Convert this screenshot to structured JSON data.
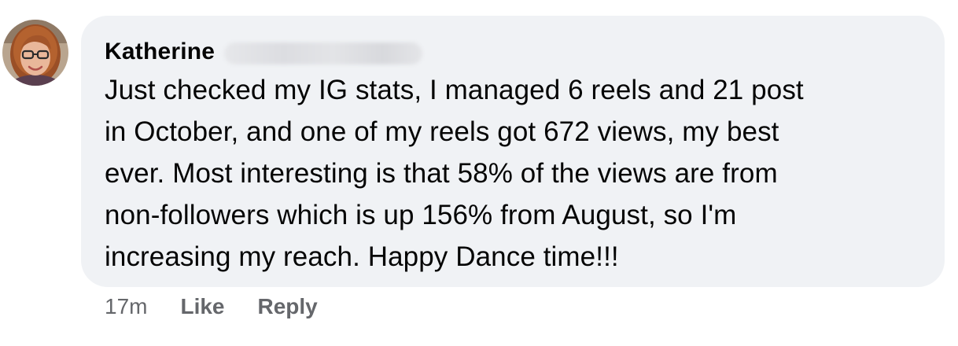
{
  "comment": {
    "author": "Katherine",
    "text": "Just checked my IG stats, I managed 6 reels and 21 post\nin October, and one of my reels got 672 views, my best\never. Most interesting is that 58% of the views are from\nnon-followers which is up 156% from August, so I'm\nincreasing my reach. Happy Dance time!!!",
    "timestamp": "17m",
    "like_label": "Like",
    "reply_label": "Reply"
  },
  "colors": {
    "bubble_bg": "#f0f2f5",
    "text": "#050505",
    "secondary_text": "#65676b"
  },
  "icons": {
    "avatar": "profile-photo"
  }
}
